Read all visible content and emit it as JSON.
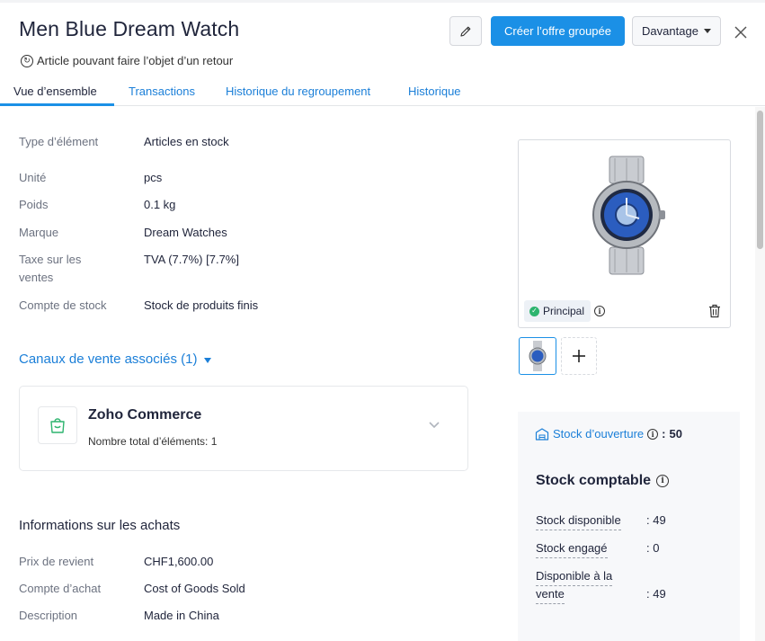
{
  "header": {
    "title": "Men Blue Dream Watch",
    "subtitle": "Article pouvant faire l’objet d’un retour",
    "primary_button": "Créer l’offre groupée",
    "more_button": "Davantage"
  },
  "tabs": [
    {
      "label": "Vue d’ensemble",
      "active": true
    },
    {
      "label": "Transactions",
      "active": false
    },
    {
      "label": "Historique du regroupement",
      "active": false
    },
    {
      "label": "Historique",
      "active": false
    }
  ],
  "details": [
    {
      "label": "Type d’élément",
      "value": "Articles en stock"
    },
    {
      "label": "Unité",
      "value": "pcs"
    },
    {
      "label": "Poids",
      "value": "0.1 kg"
    },
    {
      "label": "Marque",
      "value": "Dream Watches"
    },
    {
      "label": "Taxe sur les ventes",
      "value": "TVA (7.7%) [7.7%]"
    },
    {
      "label": "Compte de stock",
      "value": "Stock de produits finis"
    }
  ],
  "channels": {
    "toggle_label": "Canaux de vente associés (1)",
    "items": [
      {
        "name": "Zoho Commerce",
        "count_text": "Nombre total d’éléments: 1"
      }
    ]
  },
  "purchase": {
    "title": "Informations sur les achats",
    "rows": [
      {
        "label": "Prix de revient",
        "value": "CHF1,600.00"
      },
      {
        "label": "Compte d’achat",
        "value": "Cost of Goods Sold"
      },
      {
        "label": "Description",
        "value": "Made in China"
      }
    ]
  },
  "image_panel": {
    "badge": "Principal"
  },
  "stock": {
    "opening_label": "Stock d’ouverture",
    "opening_value": "50",
    "title": "Stock comptable",
    "rows": [
      {
        "label": "Stock disponible",
        "value": ": 49"
      },
      {
        "label": "Stock engagé",
        "value": ": 0"
      },
      {
        "label_line1": "Disponible à la",
        "label_line2": "vente",
        "value": ": 49"
      }
    ]
  },
  "colors": {
    "accent": "#1b90e6",
    "link": "#1b7fd8",
    "success": "#2db46e",
    "text": "#21263c"
  }
}
